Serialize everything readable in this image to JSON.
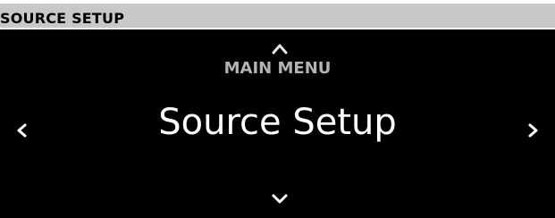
{
  "header": {
    "title": "SOURCE SETUP"
  },
  "display": {
    "context_label": "MAIN MENU",
    "current_item": "Source Setup"
  },
  "icons": {
    "up": "chevron-up-icon",
    "down": "chevron-down-icon",
    "left": "chevron-left-icon",
    "right": "chevron-right-icon"
  },
  "colors": {
    "header_background": "#c8c8c8",
    "screen_background": "#000000",
    "context_text": "#b3b3b3",
    "item_text": "#ffffff"
  }
}
